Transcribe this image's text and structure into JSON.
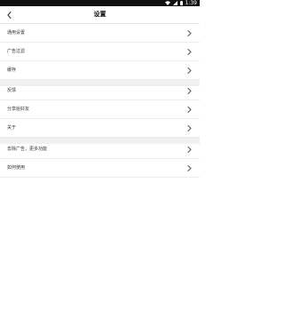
{
  "status_bar": {
    "time": "1:39"
  },
  "header": {
    "title": "设置"
  },
  "groups": [
    {
      "items": [
        {
          "label": "通用设置"
        },
        {
          "label": "广告过滤"
        },
        {
          "label": "缓存"
        }
      ]
    },
    {
      "items": [
        {
          "label": "反馈"
        },
        {
          "label": "分享给好友"
        },
        {
          "label": "关于"
        }
      ]
    },
    {
      "items": [
        {
          "label": "去除广告，更多功能"
        },
        {
          "label": "如何使用"
        }
      ]
    }
  ],
  "colors": {
    "status_bar_bg": "#111111",
    "divider_bg": "#f1f1f1",
    "row_border": "#ececec",
    "chevron": "#555555"
  },
  "icons": {
    "back": "chevron-left-icon",
    "row_arrow": "chevron-right-icon",
    "wifi": "wifi-icon",
    "signal": "signal-icon",
    "battery": "battery-icon"
  }
}
